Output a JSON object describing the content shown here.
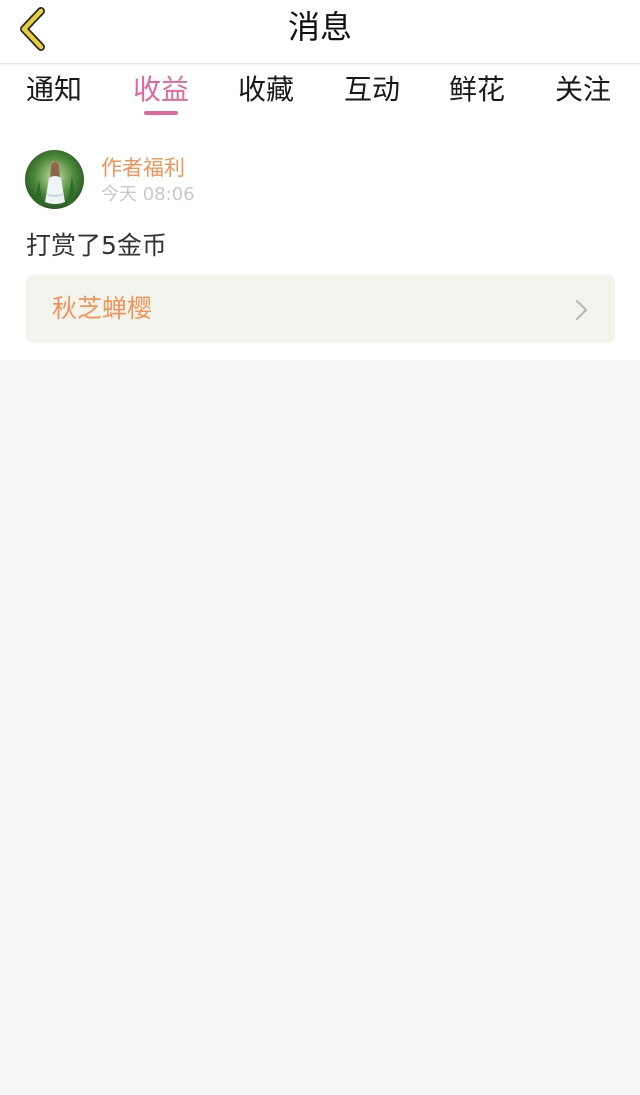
{
  "header": {
    "title": "消息",
    "back_icon": "chevron-left-icon"
  },
  "tabs": [
    {
      "label": "通知",
      "active": false
    },
    {
      "label": "收益",
      "active": true
    },
    {
      "label": "收藏",
      "active": false
    },
    {
      "label": "互动",
      "active": false
    },
    {
      "label": "鲜花",
      "active": false
    },
    {
      "label": "关注",
      "active": false
    }
  ],
  "message_item": {
    "author": "作者福利",
    "time": "今天 08:06",
    "body": "打赏了5金币",
    "work": {
      "title": "秋芝蝉樱",
      "chevron_icon": "chevron-right-icon"
    }
  },
  "colors": {
    "accent": "#e3679f",
    "orange": "#f0955a",
    "back_icon": "#e8cf3e",
    "background": "#f8f6f6",
    "card": "#f4f4ee"
  }
}
